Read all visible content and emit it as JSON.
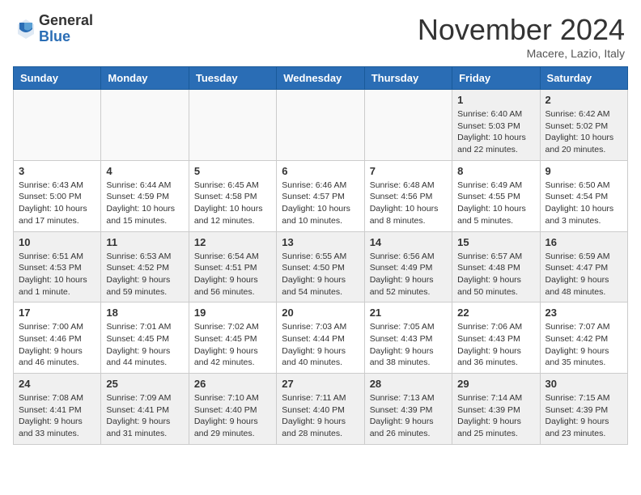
{
  "header": {
    "logo_general": "General",
    "logo_blue": "Blue",
    "month_title": "November 2024",
    "location": "Macere, Lazio, Italy"
  },
  "weekdays": [
    "Sunday",
    "Monday",
    "Tuesday",
    "Wednesday",
    "Thursday",
    "Friday",
    "Saturday"
  ],
  "weeks": [
    [
      {
        "day": "",
        "empty": true
      },
      {
        "day": "",
        "empty": true
      },
      {
        "day": "",
        "empty": true
      },
      {
        "day": "",
        "empty": true
      },
      {
        "day": "",
        "empty": true
      },
      {
        "day": "1",
        "sunrise": "6:40 AM",
        "sunset": "5:03 PM",
        "daylight": "10 hours and 22 minutes."
      },
      {
        "day": "2",
        "sunrise": "6:42 AM",
        "sunset": "5:02 PM",
        "daylight": "10 hours and 20 minutes."
      }
    ],
    [
      {
        "day": "3",
        "sunrise": "6:43 AM",
        "sunset": "5:00 PM",
        "daylight": "10 hours and 17 minutes."
      },
      {
        "day": "4",
        "sunrise": "6:44 AM",
        "sunset": "4:59 PM",
        "daylight": "10 hours and 15 minutes."
      },
      {
        "day": "5",
        "sunrise": "6:45 AM",
        "sunset": "4:58 PM",
        "daylight": "10 hours and 12 minutes."
      },
      {
        "day": "6",
        "sunrise": "6:46 AM",
        "sunset": "4:57 PM",
        "daylight": "10 hours and 10 minutes."
      },
      {
        "day": "7",
        "sunrise": "6:48 AM",
        "sunset": "4:56 PM",
        "daylight": "10 hours and 8 minutes."
      },
      {
        "day": "8",
        "sunrise": "6:49 AM",
        "sunset": "4:55 PM",
        "daylight": "10 hours and 5 minutes."
      },
      {
        "day": "9",
        "sunrise": "6:50 AM",
        "sunset": "4:54 PM",
        "daylight": "10 hours and 3 minutes."
      }
    ],
    [
      {
        "day": "10",
        "sunrise": "6:51 AM",
        "sunset": "4:53 PM",
        "daylight": "10 hours and 1 minute."
      },
      {
        "day": "11",
        "sunrise": "6:53 AM",
        "sunset": "4:52 PM",
        "daylight": "9 hours and 59 minutes."
      },
      {
        "day": "12",
        "sunrise": "6:54 AM",
        "sunset": "4:51 PM",
        "daylight": "9 hours and 56 minutes."
      },
      {
        "day": "13",
        "sunrise": "6:55 AM",
        "sunset": "4:50 PM",
        "daylight": "9 hours and 54 minutes."
      },
      {
        "day": "14",
        "sunrise": "6:56 AM",
        "sunset": "4:49 PM",
        "daylight": "9 hours and 52 minutes."
      },
      {
        "day": "15",
        "sunrise": "6:57 AM",
        "sunset": "4:48 PM",
        "daylight": "9 hours and 50 minutes."
      },
      {
        "day": "16",
        "sunrise": "6:59 AM",
        "sunset": "4:47 PM",
        "daylight": "9 hours and 48 minutes."
      }
    ],
    [
      {
        "day": "17",
        "sunrise": "7:00 AM",
        "sunset": "4:46 PM",
        "daylight": "9 hours and 46 minutes."
      },
      {
        "day": "18",
        "sunrise": "7:01 AM",
        "sunset": "4:45 PM",
        "daylight": "9 hours and 44 minutes."
      },
      {
        "day": "19",
        "sunrise": "7:02 AM",
        "sunset": "4:45 PM",
        "daylight": "9 hours and 42 minutes."
      },
      {
        "day": "20",
        "sunrise": "7:03 AM",
        "sunset": "4:44 PM",
        "daylight": "9 hours and 40 minutes."
      },
      {
        "day": "21",
        "sunrise": "7:05 AM",
        "sunset": "4:43 PM",
        "daylight": "9 hours and 38 minutes."
      },
      {
        "day": "22",
        "sunrise": "7:06 AM",
        "sunset": "4:43 PM",
        "daylight": "9 hours and 36 minutes."
      },
      {
        "day": "23",
        "sunrise": "7:07 AM",
        "sunset": "4:42 PM",
        "daylight": "9 hours and 35 minutes."
      }
    ],
    [
      {
        "day": "24",
        "sunrise": "7:08 AM",
        "sunset": "4:41 PM",
        "daylight": "9 hours and 33 minutes."
      },
      {
        "day": "25",
        "sunrise": "7:09 AM",
        "sunset": "4:41 PM",
        "daylight": "9 hours and 31 minutes."
      },
      {
        "day": "26",
        "sunrise": "7:10 AM",
        "sunset": "4:40 PM",
        "daylight": "9 hours and 29 minutes."
      },
      {
        "day": "27",
        "sunrise": "7:11 AM",
        "sunset": "4:40 PM",
        "daylight": "9 hours and 28 minutes."
      },
      {
        "day": "28",
        "sunrise": "7:13 AM",
        "sunset": "4:39 PM",
        "daylight": "9 hours and 26 minutes."
      },
      {
        "day": "29",
        "sunrise": "7:14 AM",
        "sunset": "4:39 PM",
        "daylight": "9 hours and 25 minutes."
      },
      {
        "day": "30",
        "sunrise": "7:15 AM",
        "sunset": "4:39 PM",
        "daylight": "9 hours and 23 minutes."
      }
    ]
  ]
}
